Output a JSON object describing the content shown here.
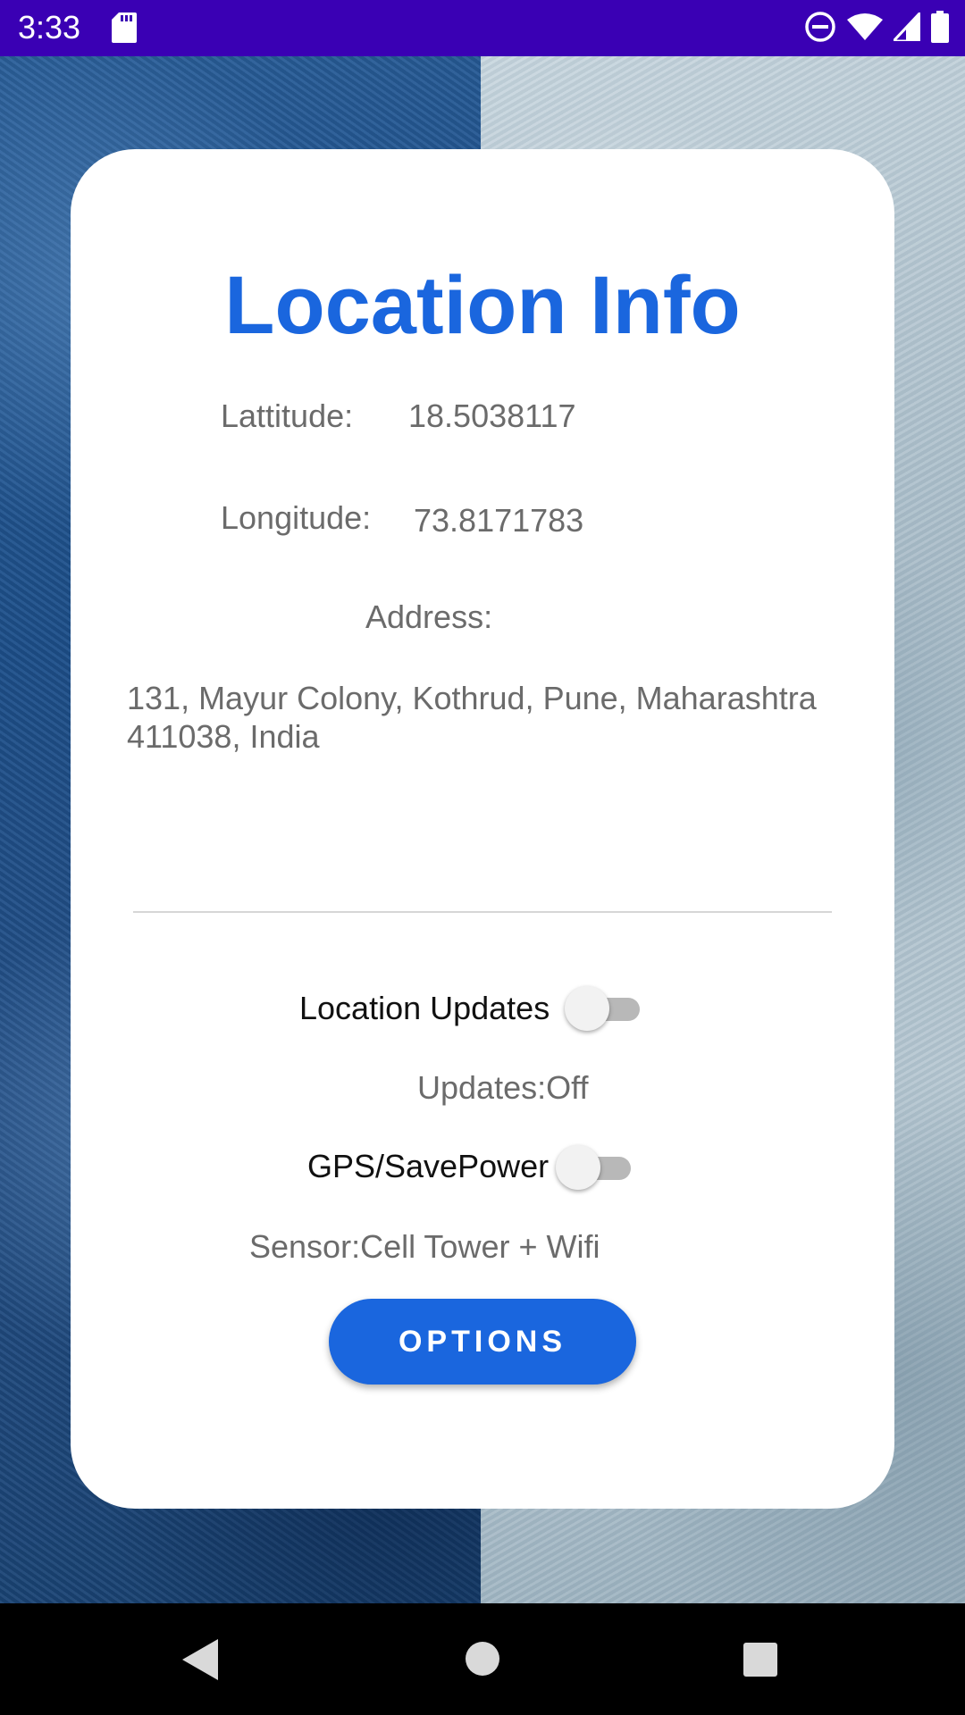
{
  "status_bar": {
    "time": "3:33",
    "icons": [
      "sd-card-icon",
      "do-not-disturb-icon",
      "wifi-icon",
      "cell-signal-icon",
      "battery-icon"
    ]
  },
  "card": {
    "title": "Location Info",
    "latitude_label": "Lattitude:",
    "latitude_value": "18.5038117",
    "longitude_label": "Longitude:",
    "longitude_value": "73.8171783",
    "address_label": "Address:",
    "address_value": "131, Mayur Colony, Kothrud, Pune, Maharashtra 411038, India",
    "location_updates_label": "Location Updates",
    "location_updates_on": false,
    "updates_status": "Updates:Off",
    "gps_label": "GPS/SavePower",
    "gps_on": false,
    "sensor_status": "Sensor:Cell Tower + Wifi",
    "options_button": "OPTIONS"
  },
  "colors": {
    "status_bar": "#3a00b4",
    "accent": "#1a66de",
    "card": "#ffffff",
    "nav_bar": "#000000"
  },
  "nav_bar": {
    "icons": [
      "back-icon",
      "home-icon",
      "recents-icon"
    ]
  }
}
